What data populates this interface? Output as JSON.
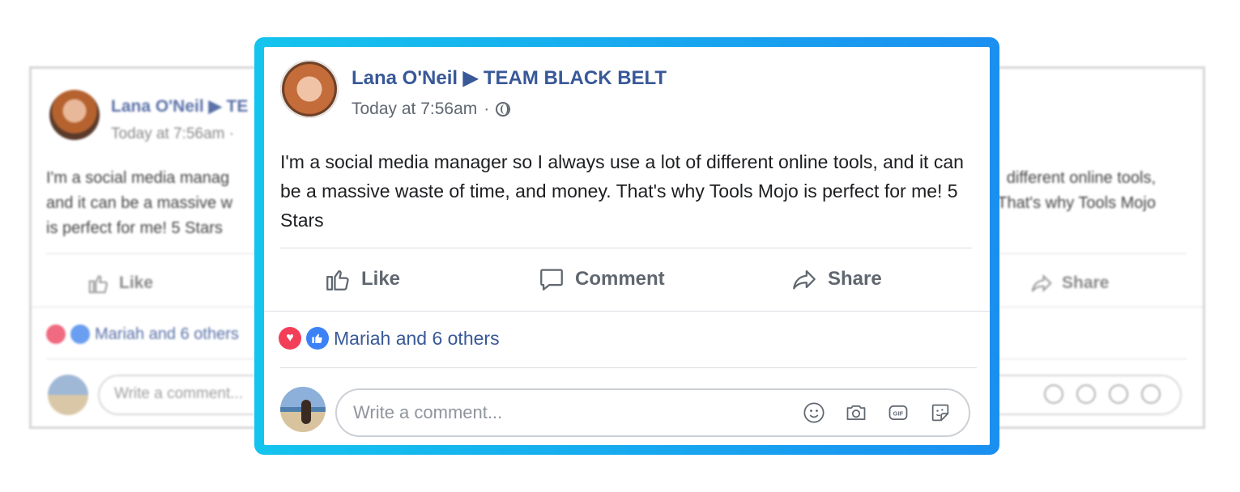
{
  "post": {
    "author": "Lana O'Neil",
    "arrow": "▶",
    "group": "TEAM BLACK BELT",
    "timestamp": "Today at 7:56am",
    "separator": "·",
    "text": "I'm a social media manager so I always use a lot of different online tools, and it can be a massive waste of time, and money. That's why Tools Mojo is perfect for me! 5 Stars"
  },
  "actions": {
    "like": "Like",
    "comment": "Comment",
    "share": "Share"
  },
  "reactions": {
    "summary": "Mariah and 6 others"
  },
  "comment_input": {
    "placeholder": "Write a comment..."
  },
  "background_card": {
    "author_partial": "Lana O'Neil ▶ TE",
    "time_partial": "Today at 7:56am · ",
    "left_lines": [
      "I'm a social media manag",
      "and it can be a massive w",
      "is perfect for me! 5 Stars"
    ],
    "right_lines": [
      "different online tools,",
      "That's why Tools Mojo"
    ],
    "like": "Like",
    "share": "Share",
    "reactions": "Mariah and 6 others",
    "placeholder": "Write a comment..."
  },
  "colors": {
    "frame_start": "#14c4ee",
    "frame_end": "#1a8ff0",
    "link_blue": "#385898",
    "heart": "#f33e58",
    "like_blue": "#3b82f6"
  }
}
